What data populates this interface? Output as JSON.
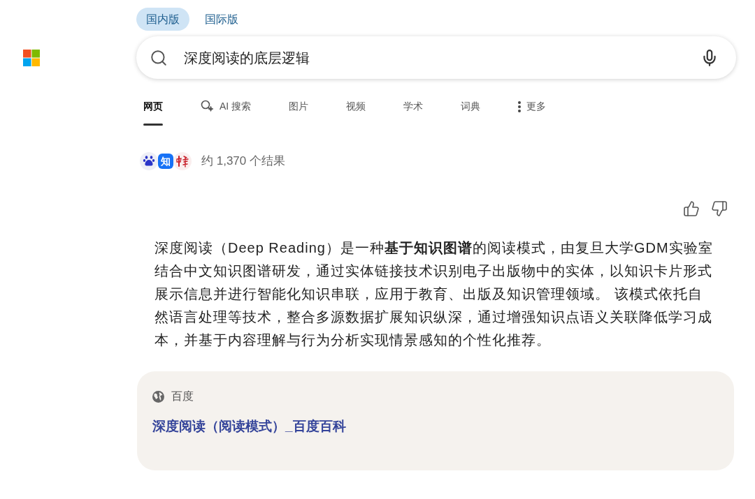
{
  "edition_tabs": [
    {
      "label": "国内版",
      "selected": true
    },
    {
      "label": "国际版",
      "selected": false
    }
  ],
  "search": {
    "value": "深度阅读的底层逻辑"
  },
  "nav_tabs": [
    {
      "label": "网页",
      "selected": true,
      "kind": "plain"
    },
    {
      "label": "AI 搜索",
      "selected": false,
      "kind": "ai"
    },
    {
      "label": "图片",
      "selected": false,
      "kind": "plain"
    },
    {
      "label": "视频",
      "selected": false,
      "kind": "plain"
    },
    {
      "label": "学术",
      "selected": false,
      "kind": "plain"
    },
    {
      "label": "词典",
      "selected": false,
      "kind": "plain"
    },
    {
      "label": "更多",
      "selected": false,
      "kind": "more"
    }
  ],
  "results": {
    "sources": [
      {
        "kind": "paw"
      },
      {
        "kind": "letter",
        "label": "知"
      },
      {
        "kind": "brush"
      }
    ],
    "count": "约 1,370 个结果"
  },
  "answer": {
    "text": "深度阅读（Deep Reading）是一种**基于知识图谱**的阅读模式，由复旦大学GDM实验室结合中文知识图谱研发，通过实体链接技术识别电子出版物中的实体，以知识卡片形式展示信息并进行智能化知识串联，应用于教育、出版及知识管理领域。 该模式依托自然语言处理等技术，整合多源数据扩展知识纵深，通过增强知识点语义关联降低学习成本，并基于内容理解与行为分析实现情景感知的个性化推荐。"
  },
  "source_card": {
    "site": "百度",
    "title": "深度阅读（阅读模式）_百度百科"
  }
}
